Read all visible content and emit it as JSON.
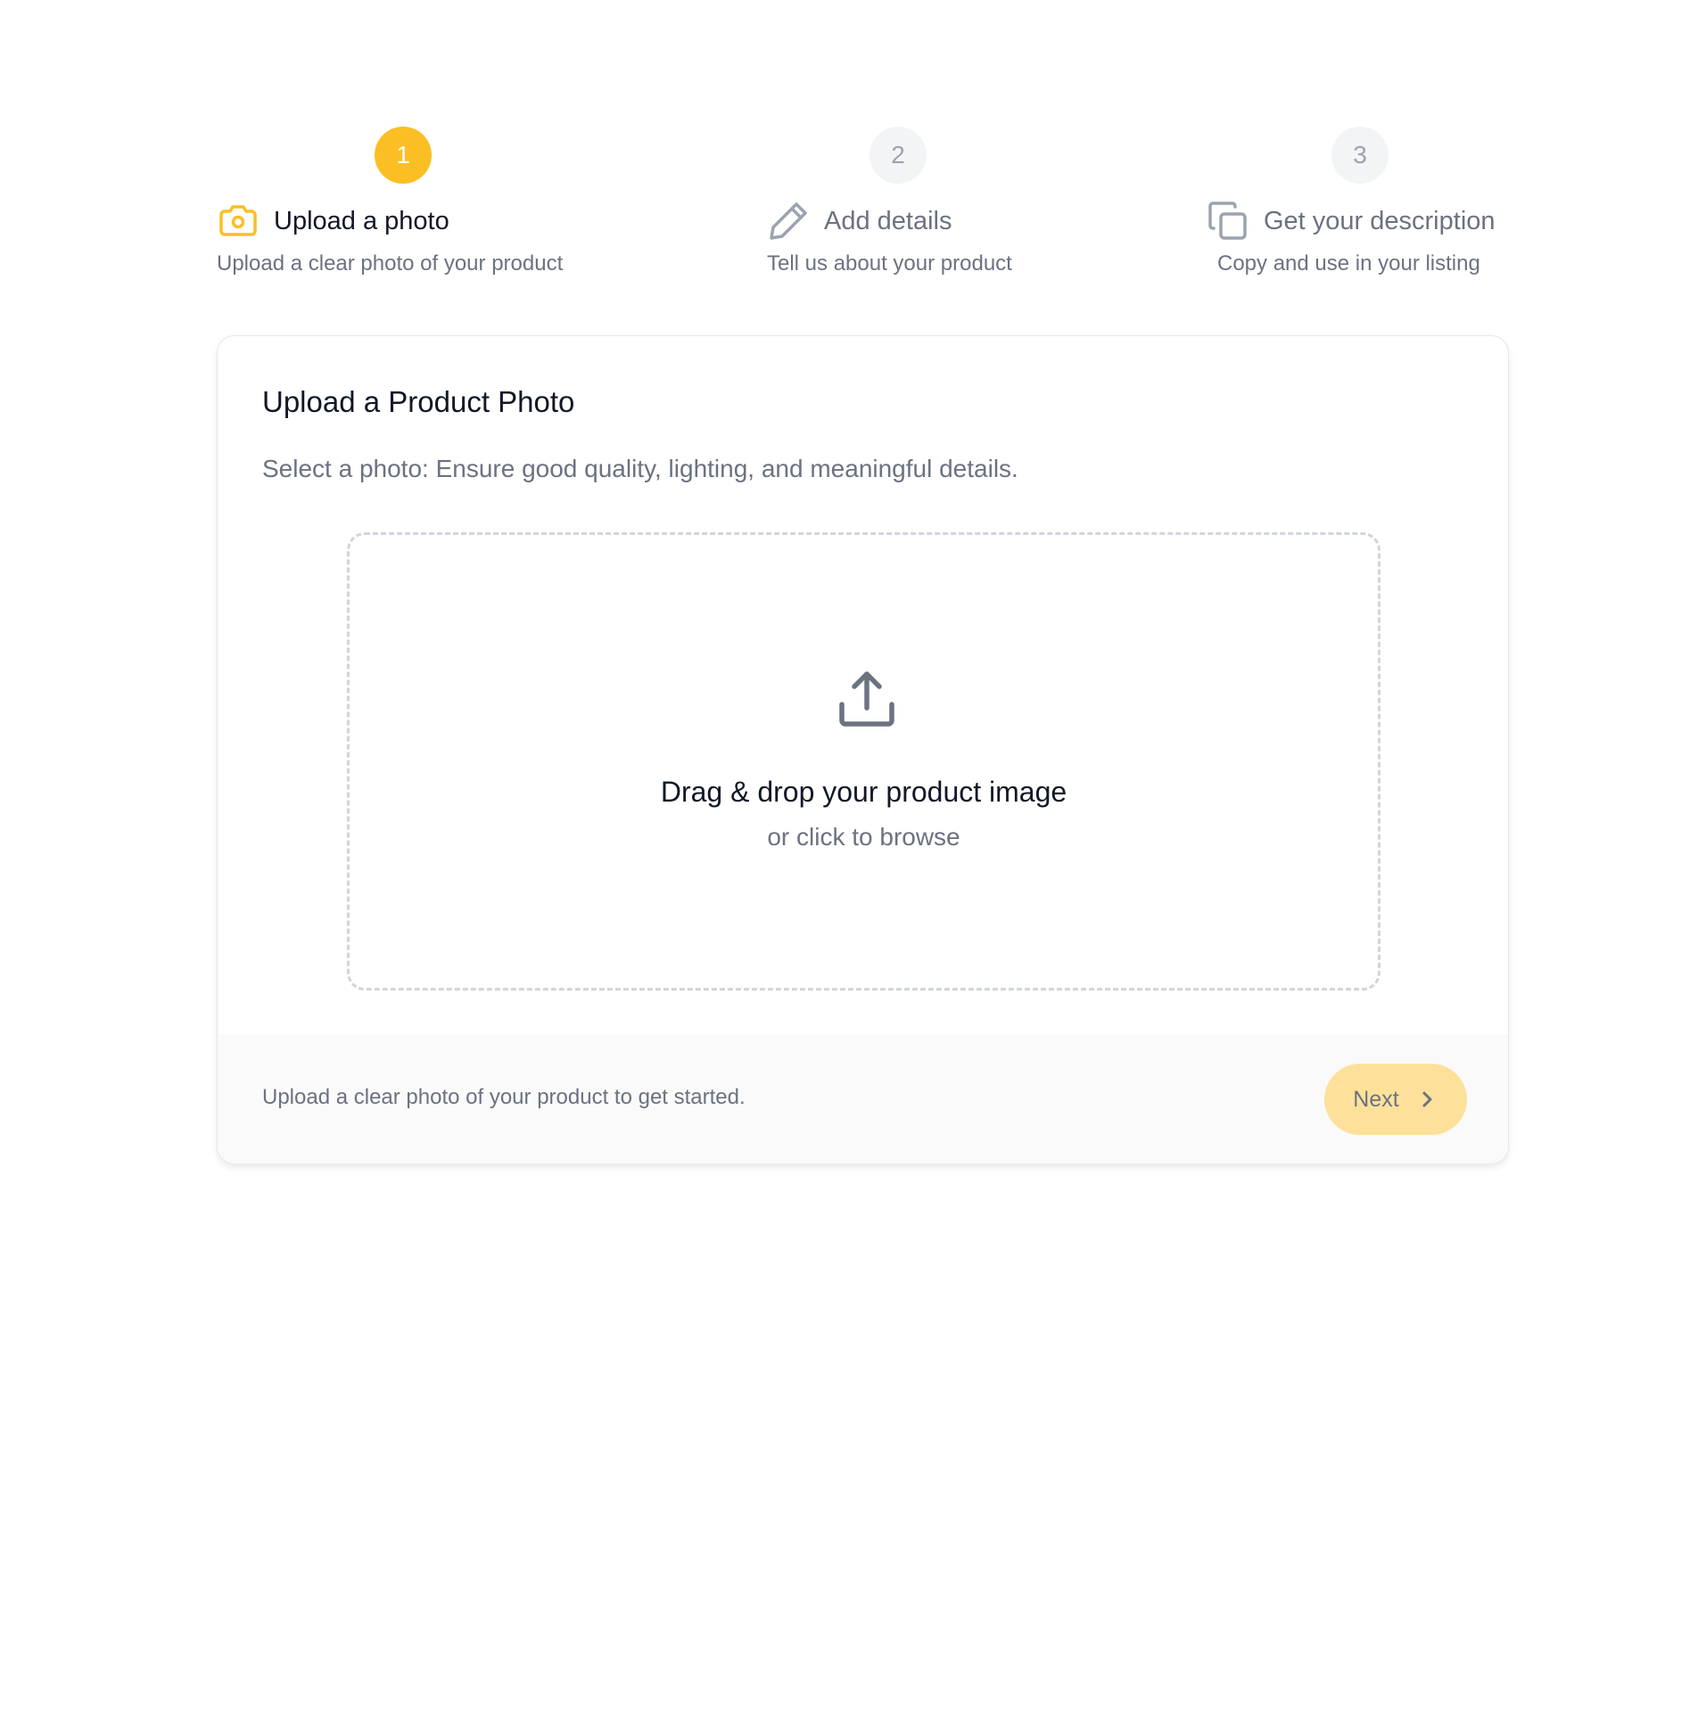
{
  "stepper": {
    "steps": [
      {
        "number": "1",
        "title": "Upload a photo",
        "description": "Upload a clear photo of your product",
        "icon": "camera-icon",
        "state": "active"
      },
      {
        "number": "2",
        "title": "Add details",
        "description": "Tell us about your product",
        "icon": "pencil-icon",
        "state": "inactive"
      },
      {
        "number": "3",
        "title": "Get your description",
        "description": "Copy and use in your listing",
        "icon": "copy-icon",
        "state": "inactive"
      }
    ]
  },
  "card": {
    "title": "Upload a Product Photo",
    "subtitle": "Select a photo: Ensure good quality, lighting, and meaningful details.",
    "dropzone": {
      "icon": "upload-icon",
      "title": "Drag & drop your product image",
      "subtitle": "or click to browse"
    },
    "footer": {
      "text": "Upload a clear photo of your product to get started.",
      "next_label": "Next",
      "next_icon": "chevron-right-icon"
    }
  },
  "colors": {
    "accent": "#fbbf24",
    "accent_light": "#fde19a",
    "muted_text": "#6b7280",
    "inactive_circle": "#f3f4f6"
  }
}
